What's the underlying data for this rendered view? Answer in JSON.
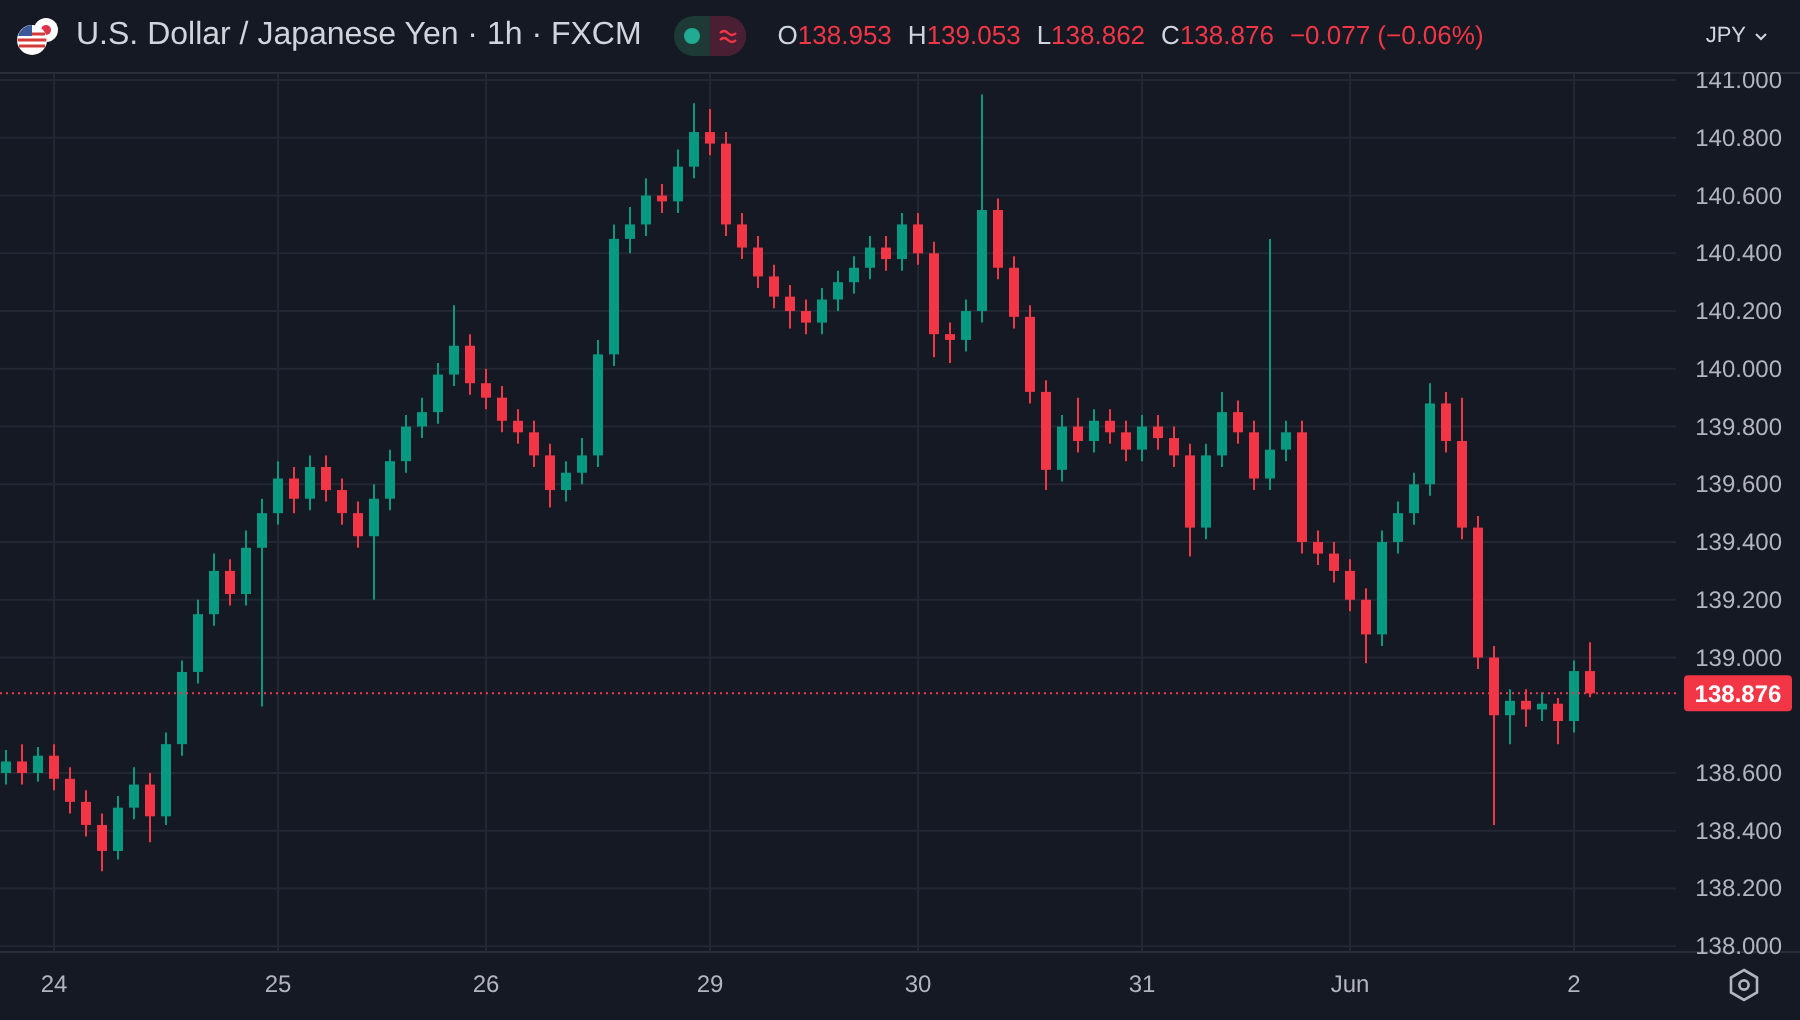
{
  "header": {
    "symbol_title": "U.S. Dollar / Japanese Yen · 1h · FXCM",
    "market_open": true,
    "ohlc": [
      {
        "key": "O",
        "value": "138.953"
      },
      {
        "key": "H",
        "value": "139.053"
      },
      {
        "key": "L",
        "value": "138.862"
      },
      {
        "key": "C",
        "value": "138.876"
      }
    ],
    "change": "−0.077 (−0.06%)"
  },
  "currency_button": {
    "label": "JPY"
  },
  "last_price": "138.876",
  "chart_data": {
    "type": "candlestick",
    "categories": [
      null,
      null,
      null,
      "24",
      null,
      null,
      null,
      null,
      null,
      null,
      null,
      null,
      null,
      null,
      null,
      null,
      null,
      "25",
      null,
      null,
      null,
      null,
      null,
      null,
      null,
      null,
      null,
      null,
      null,
      null,
      "26",
      null,
      null,
      null,
      null,
      null,
      null,
      null,
      null,
      null,
      null,
      null,
      null,
      null,
      "29",
      null,
      null,
      null,
      null,
      null,
      null,
      null,
      null,
      null,
      null,
      null,
      null,
      "30",
      null,
      null,
      null,
      null,
      null,
      null,
      null,
      null,
      null,
      null,
      null,
      null,
      null,
      "31",
      null,
      null,
      null,
      null,
      null,
      null,
      null,
      null,
      null,
      null,
      null,
      null,
      "Jun",
      null,
      null,
      null,
      null,
      null,
      null,
      null,
      null,
      null,
      null,
      null,
      null,
      null,
      "2",
      null
    ],
    "ohlc": [
      [
        138.6,
        138.68,
        138.56,
        138.64
      ],
      [
        138.64,
        138.7,
        138.56,
        138.6
      ],
      [
        138.6,
        138.69,
        138.57,
        138.66
      ],
      [
        138.66,
        138.7,
        138.54,
        138.58
      ],
      [
        138.58,
        138.62,
        138.46,
        138.5
      ],
      [
        138.5,
        138.54,
        138.38,
        138.42
      ],
      [
        138.42,
        138.46,
        138.26,
        138.33
      ],
      [
        138.33,
        138.52,
        138.3,
        138.48
      ],
      [
        138.48,
        138.62,
        138.44,
        138.56
      ],
      [
        138.56,
        138.6,
        138.36,
        138.45
      ],
      [
        138.45,
        138.74,
        138.42,
        138.7
      ],
      [
        138.7,
        138.99,
        138.66,
        138.95
      ],
      [
        138.95,
        139.2,
        138.91,
        139.15
      ],
      [
        139.15,
        139.36,
        139.11,
        139.3
      ],
      [
        139.3,
        139.34,
        139.18,
        139.22
      ],
      [
        139.22,
        139.44,
        139.18,
        139.38
      ],
      [
        139.38,
        139.55,
        138.83,
        139.5
      ],
      [
        139.5,
        139.68,
        139.46,
        139.62
      ],
      [
        139.62,
        139.66,
        139.5,
        139.55
      ],
      [
        139.55,
        139.7,
        139.51,
        139.66
      ],
      [
        139.66,
        139.7,
        139.54,
        139.58
      ],
      [
        139.58,
        139.62,
        139.46,
        139.5
      ],
      [
        139.5,
        139.54,
        139.38,
        139.42
      ],
      [
        139.42,
        139.6,
        139.2,
        139.55
      ],
      [
        139.55,
        139.72,
        139.51,
        139.68
      ],
      [
        139.68,
        139.84,
        139.64,
        139.8
      ],
      [
        139.8,
        139.9,
        139.76,
        139.85
      ],
      [
        139.85,
        140.02,
        139.81,
        139.98
      ],
      [
        139.98,
        140.22,
        139.94,
        140.08
      ],
      [
        140.08,
        140.12,
        139.91,
        139.95
      ],
      [
        139.95,
        140.0,
        139.86,
        139.9
      ],
      [
        139.9,
        139.94,
        139.78,
        139.82
      ],
      [
        139.82,
        139.86,
        139.74,
        139.78
      ],
      [
        139.78,
        139.82,
        139.66,
        139.7
      ],
      [
        139.7,
        139.74,
        139.52,
        139.58
      ],
      [
        139.58,
        139.68,
        139.54,
        139.64
      ],
      [
        139.64,
        139.76,
        139.6,
        139.7
      ],
      [
        139.7,
        140.1,
        139.66,
        140.05
      ],
      [
        140.05,
        140.5,
        140.01,
        140.45
      ],
      [
        140.45,
        140.56,
        140.4,
        140.5
      ],
      [
        140.5,
        140.66,
        140.46,
        140.6
      ],
      [
        140.6,
        140.64,
        140.54,
        140.58
      ],
      [
        140.58,
        140.76,
        140.54,
        140.7
      ],
      [
        140.7,
        140.92,
        140.66,
        140.82
      ],
      [
        140.82,
        140.9,
        140.74,
        140.78
      ],
      [
        140.78,
        140.82,
        140.46,
        140.5
      ],
      [
        140.5,
        140.54,
        140.38,
        140.42
      ],
      [
        140.42,
        140.46,
        140.28,
        140.32
      ],
      [
        140.32,
        140.36,
        140.21,
        140.25
      ],
      [
        140.25,
        140.29,
        140.14,
        140.2
      ],
      [
        140.2,
        140.24,
        140.12,
        140.16
      ],
      [
        140.16,
        140.28,
        140.12,
        140.24
      ],
      [
        140.24,
        140.34,
        140.2,
        140.3
      ],
      [
        140.3,
        140.39,
        140.26,
        140.35
      ],
      [
        140.35,
        140.46,
        140.31,
        140.42
      ],
      [
        140.42,
        140.46,
        140.34,
        140.38
      ],
      [
        140.38,
        140.54,
        140.34,
        140.5
      ],
      [
        140.5,
        140.54,
        140.36,
        140.4
      ],
      [
        140.4,
        140.44,
        140.04,
        140.12
      ],
      [
        140.12,
        140.16,
        140.02,
        140.1
      ],
      [
        140.1,
        140.24,
        140.06,
        140.2
      ],
      [
        140.2,
        140.95,
        140.16,
        140.55
      ],
      [
        140.55,
        140.59,
        140.31,
        140.35
      ],
      [
        140.35,
        140.39,
        140.14,
        140.18
      ],
      [
        140.18,
        140.22,
        139.88,
        139.92
      ],
      [
        139.92,
        139.96,
        139.58,
        139.65
      ],
      [
        139.65,
        139.84,
        139.61,
        139.8
      ],
      [
        139.8,
        139.9,
        139.71,
        139.75
      ],
      [
        139.75,
        139.86,
        139.71,
        139.82
      ],
      [
        139.82,
        139.86,
        139.74,
        139.78
      ],
      [
        139.78,
        139.82,
        139.68,
        139.72
      ],
      [
        139.72,
        139.84,
        139.68,
        139.8
      ],
      [
        139.8,
        139.84,
        139.72,
        139.76
      ],
      [
        139.76,
        139.8,
        139.66,
        139.7
      ],
      [
        139.7,
        139.74,
        139.35,
        139.45
      ],
      [
        139.45,
        139.74,
        139.41,
        139.7
      ],
      [
        139.7,
        139.92,
        139.66,
        139.85
      ],
      [
        139.85,
        139.89,
        139.74,
        139.78
      ],
      [
        139.78,
        139.82,
        139.58,
        139.62
      ],
      [
        139.62,
        140.45,
        139.58,
        139.72
      ],
      [
        139.72,
        139.82,
        139.68,
        139.78
      ],
      [
        139.78,
        139.82,
        139.36,
        139.4
      ],
      [
        139.4,
        139.44,
        139.32,
        139.36
      ],
      [
        139.36,
        139.4,
        139.26,
        139.3
      ],
      [
        139.3,
        139.34,
        139.16,
        139.2
      ],
      [
        139.2,
        139.24,
        138.98,
        139.08
      ],
      [
        139.08,
        139.44,
        139.04,
        139.4
      ],
      [
        139.4,
        139.54,
        139.36,
        139.5
      ],
      [
        139.5,
        139.64,
        139.46,
        139.6
      ],
      [
        139.6,
        139.95,
        139.56,
        139.88
      ],
      [
        139.88,
        139.92,
        139.71,
        139.75
      ],
      [
        139.75,
        139.9,
        139.41,
        139.45
      ],
      [
        139.45,
        139.49,
        138.96,
        139.0
      ],
      [
        139.0,
        139.04,
        138.42,
        138.8
      ],
      [
        138.8,
        138.89,
        138.7,
        138.85
      ],
      [
        138.85,
        138.89,
        138.76,
        138.82
      ],
      [
        138.82,
        138.88,
        138.78,
        138.84
      ],
      [
        138.84,
        138.86,
        138.7,
        138.78
      ],
      [
        138.78,
        138.99,
        138.74,
        138.953
      ],
      [
        138.953,
        139.053,
        138.862,
        138.876
      ]
    ],
    "ylim": [
      137.98,
      141.028
    ],
    "grid": true,
    "ref_lines": [
      {
        "axis": "y",
        "value": 138.876,
        "color": "#f23645"
      }
    ],
    "yticks": [
      {
        "value": 141,
        "label": "141.000"
      },
      {
        "value": 140.8,
        "label": "140.800"
      },
      {
        "value": 140.6,
        "label": "140.600"
      },
      {
        "value": 140.4,
        "label": "140.400"
      },
      {
        "value": 140.2,
        "label": "140.200"
      },
      {
        "value": 140,
        "label": "140.000"
      },
      {
        "value": 139.8,
        "label": "139.800"
      },
      {
        "value": 139.6,
        "label": "139.600"
      },
      {
        "value": 139.4,
        "label": "139.400"
      },
      {
        "value": 139.2,
        "label": "139.200"
      },
      {
        "value": 139,
        "label": "139.000"
      },
      {
        "value": 138.6,
        "label": "138.600"
      },
      {
        "value": 138.4,
        "label": "138.400"
      },
      {
        "value": 138.2,
        "label": "138.200"
      },
      {
        "value": 138,
        "label": "138.000"
      }
    ]
  }
}
